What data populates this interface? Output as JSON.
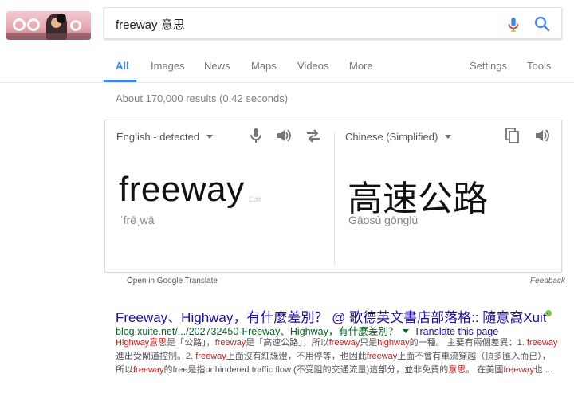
{
  "header": {
    "search_value": "freeway 意思"
  },
  "tabs": [
    {
      "label": "All"
    },
    {
      "label": "Images"
    },
    {
      "label": "News"
    },
    {
      "label": "Maps"
    },
    {
      "label": "Videos"
    },
    {
      "label": "More"
    },
    {
      "label": "Settings"
    },
    {
      "label": "Tools"
    }
  ],
  "result_stats": "About 170,000 results (0.42 seconds)",
  "translate": {
    "source_lang": "English - detected",
    "target_lang": "Chinese (Simplified)",
    "source_word": "freeway",
    "edit_label": "Edit",
    "source_pronunciation": "ˈfrēˌwā",
    "target_word": "高速公路",
    "target_pronunciation": "Gāosù gōnglù",
    "open_link": "Open in Google Translate",
    "feedback": "Feedback"
  },
  "result": {
    "title": "Freeway、Highway，有什麼差別？ @ 歌德英文書店部落格:: 隨意窩Xuite ...",
    "url": "blog.xuite.net/.../202732450-Freeway、Highway，有什麼差別？",
    "translate_link": "Translate this page",
    "snippet_segments": [
      {
        "text": "Highway意思",
        "hl": true
      },
      {
        "text": "是「公路」，",
        "hl": false
      },
      {
        "text": "freeway",
        "hl": true
      },
      {
        "text": "是「高速公路」，所以",
        "hl": false
      },
      {
        "text": "freeway",
        "hl": true
      },
      {
        "text": "只是",
        "hl": false
      },
      {
        "text": "highway",
        "hl": true
      },
      {
        "text": "的一種。 主要有兩個差異：1. ",
        "hl": false
      },
      {
        "text": "freeway",
        "hl": true
      },
      {
        "text": "進出受閘道控制。2. ",
        "hl": false
      },
      {
        "text": "freeway",
        "hl": true
      },
      {
        "text": "上面沒有紅綠燈，不用停等，也因此",
        "hl": false
      },
      {
        "text": "freeway",
        "hl": true
      },
      {
        "text": "上面不會有車流穿越（頂多匯入而已），所以",
        "hl": false
      },
      {
        "text": "freeway",
        "hl": true
      },
      {
        "text": "的free是指unhindered traffic flow (不受阻的交通流量)這部分，並非免費的",
        "hl": false
      },
      {
        "text": "意思",
        "hl": true
      },
      {
        "text": "。 在美國",
        "hl": false
      },
      {
        "text": "freeway",
        "hl": true
      },
      {
        "text": "也 ...",
        "hl": false
      }
    ]
  },
  "colors": {
    "accent": "#4285f4",
    "link": "#1a0dab",
    "url": "#006621",
    "highlight": "#c5221f"
  }
}
